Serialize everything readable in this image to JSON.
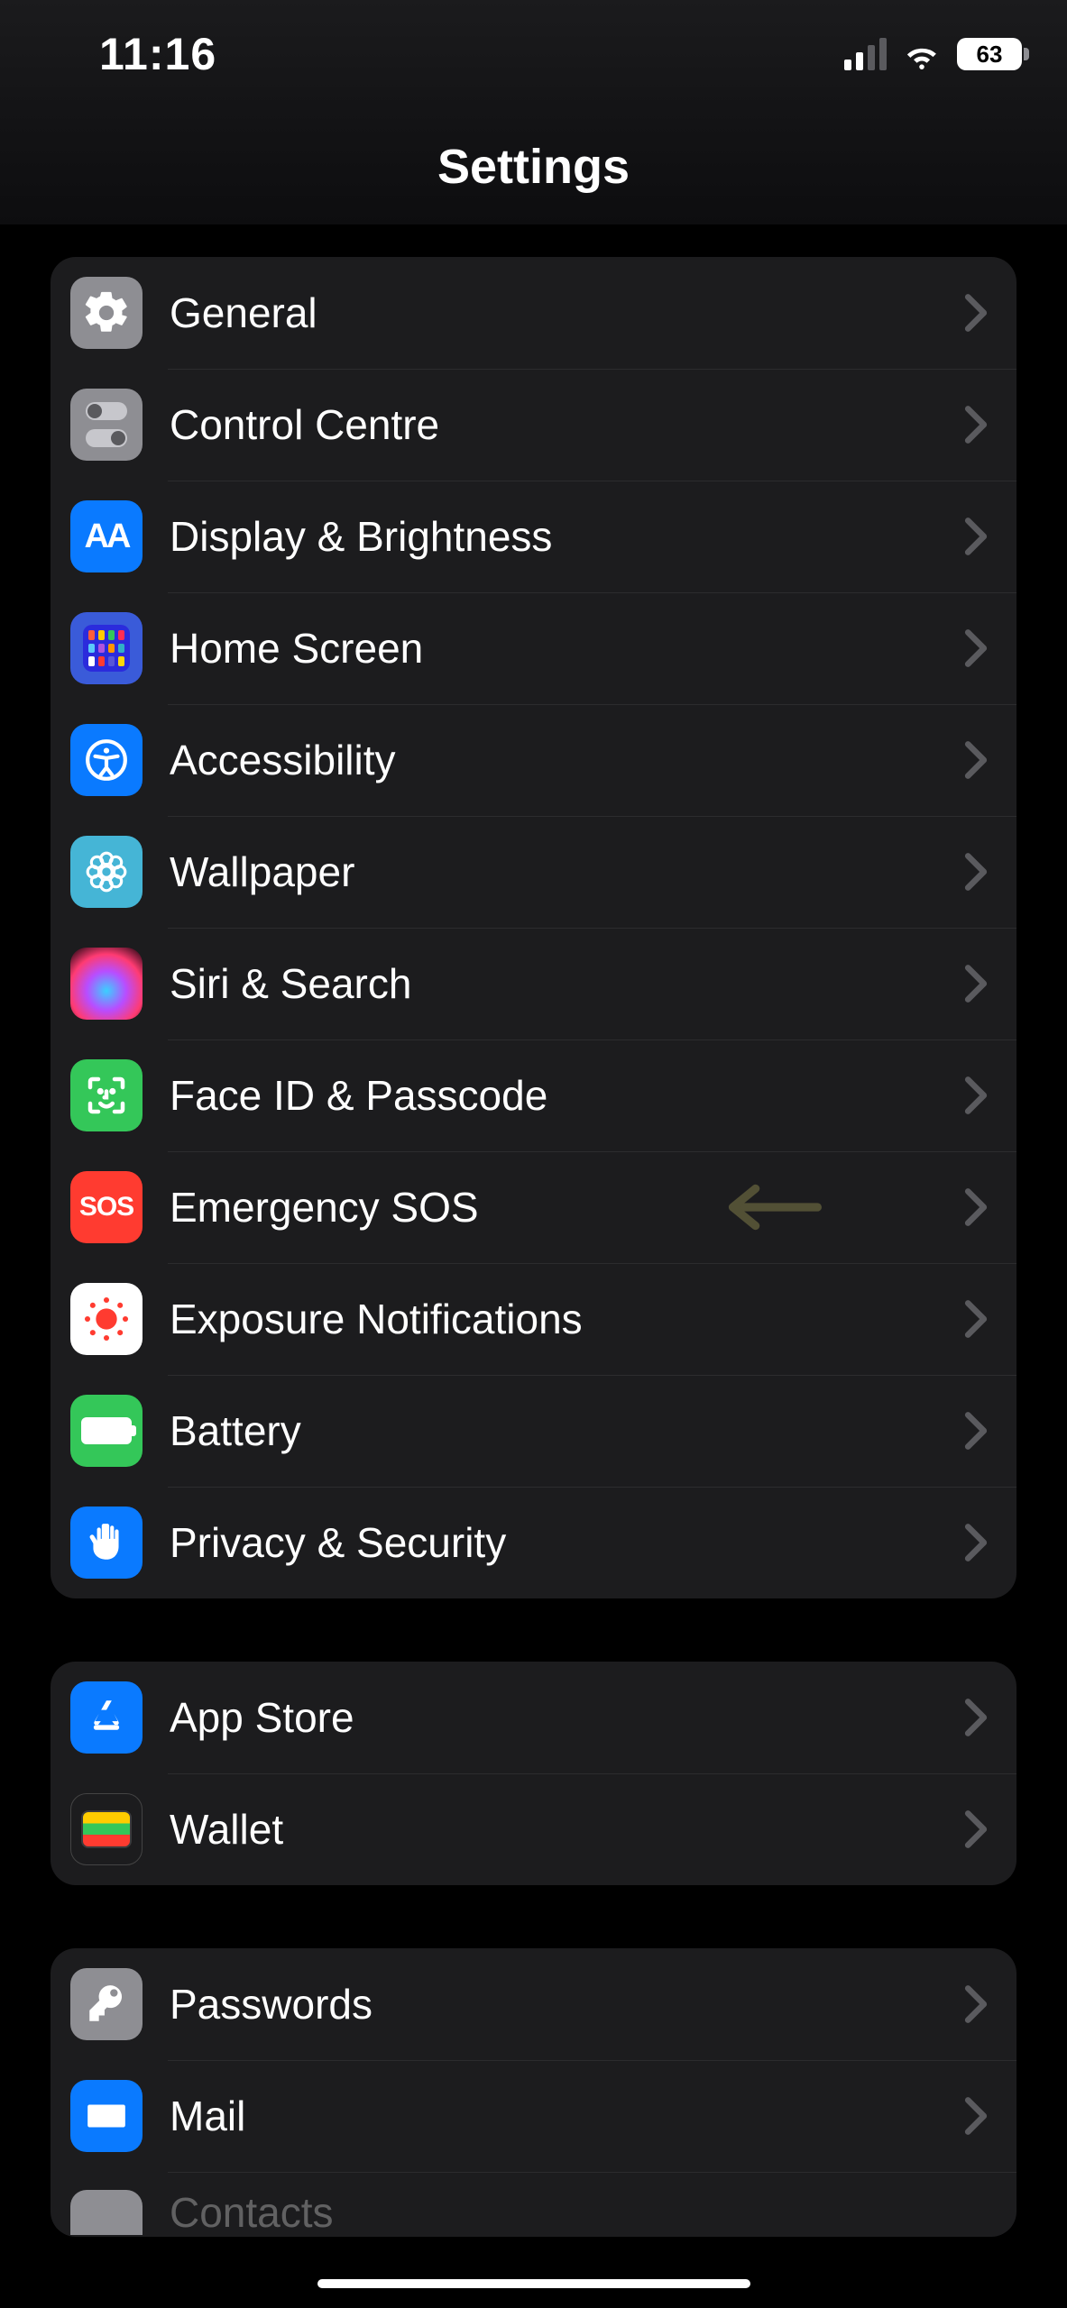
{
  "status": {
    "time": "11:16",
    "battery_percent": "63"
  },
  "header": {
    "title": "Settings"
  },
  "groups": [
    {
      "id": "system",
      "items": [
        {
          "id": "general",
          "label": "General",
          "icon": "gear-icon",
          "bg": "bg-gray"
        },
        {
          "id": "control-centre",
          "label": "Control Centre",
          "icon": "toggles-icon",
          "bg": "bg-gray"
        },
        {
          "id": "display-brightness",
          "label": "Display & Brightness",
          "icon": "text-size-icon",
          "bg": "bg-blue"
        },
        {
          "id": "home-screen",
          "label": "Home Screen",
          "icon": "apps-grid-icon",
          "bg": "bg-indigo"
        },
        {
          "id": "accessibility",
          "label": "Accessibility",
          "icon": "accessibility-icon",
          "bg": "bg-blue"
        },
        {
          "id": "wallpaper",
          "label": "Wallpaper",
          "icon": "flower-icon",
          "bg": "bg-cyan"
        },
        {
          "id": "siri-search",
          "label": "Siri & Search",
          "icon": "siri-icon",
          "bg": "bg-siri"
        },
        {
          "id": "face-id",
          "label": "Face ID & Passcode",
          "icon": "face-id-icon",
          "bg": "bg-green"
        },
        {
          "id": "emergency-sos",
          "label": "Emergency SOS",
          "icon": "sos-icon",
          "bg": "bg-red",
          "highlight_arrow": true
        },
        {
          "id": "exposure-notifications",
          "label": "Exposure Notifications",
          "icon": "exposure-icon",
          "bg": "bg-white"
        },
        {
          "id": "battery",
          "label": "Battery",
          "icon": "battery-icon",
          "bg": "bg-green"
        },
        {
          "id": "privacy-security",
          "label": "Privacy & Security",
          "icon": "hand-icon",
          "bg": "bg-blue"
        }
      ]
    },
    {
      "id": "store",
      "items": [
        {
          "id": "app-store",
          "label": "App Store",
          "icon": "app-store-icon",
          "bg": "bg-blue"
        },
        {
          "id": "wallet",
          "label": "Wallet",
          "icon": "wallet-icon",
          "bg": "bg-wallet"
        }
      ]
    },
    {
      "id": "accounts",
      "items": [
        {
          "id": "passwords",
          "label": "Passwords",
          "icon": "key-icon",
          "bg": "bg-gray"
        },
        {
          "id": "mail",
          "label": "Mail",
          "icon": "mail-icon",
          "bg": "bg-blue"
        },
        {
          "id": "contacts",
          "label": "Contacts",
          "icon": "contacts-icon",
          "bg": "bg-gray"
        }
      ]
    }
  ]
}
